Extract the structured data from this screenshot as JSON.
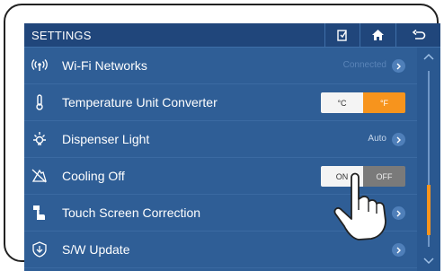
{
  "header": {
    "title": "SETTINGS",
    "buttons": [
      "clipboard-icon",
      "home-icon",
      "back-icon"
    ]
  },
  "rows": [
    {
      "icon": "wifi-icon",
      "label": "Wi-Fi Networks",
      "value": "Connected",
      "control": "chevron"
    },
    {
      "icon": "thermometer-icon",
      "label": "Temperature Unit Converter",
      "control": "toggle",
      "options": [
        "°C",
        "°F"
      ],
      "selected": "°F"
    },
    {
      "icon": "light-icon",
      "label": "Dispenser Light",
      "value": "Auto",
      "control": "chevron"
    },
    {
      "icon": "cooling-off-icon",
      "label": "Cooling Off",
      "control": "toggle",
      "options": [
        "ON",
        "OFF"
      ],
      "selected": "ON"
    },
    {
      "icon": "touch-icon",
      "label": "Touch Screen Correction",
      "control": "chevron"
    },
    {
      "icon": "update-icon",
      "label": "S/W Update",
      "control": "chevron"
    }
  ],
  "colors": {
    "accent": "#f7941d",
    "background": "#2f5e96",
    "header": "#20467b"
  }
}
